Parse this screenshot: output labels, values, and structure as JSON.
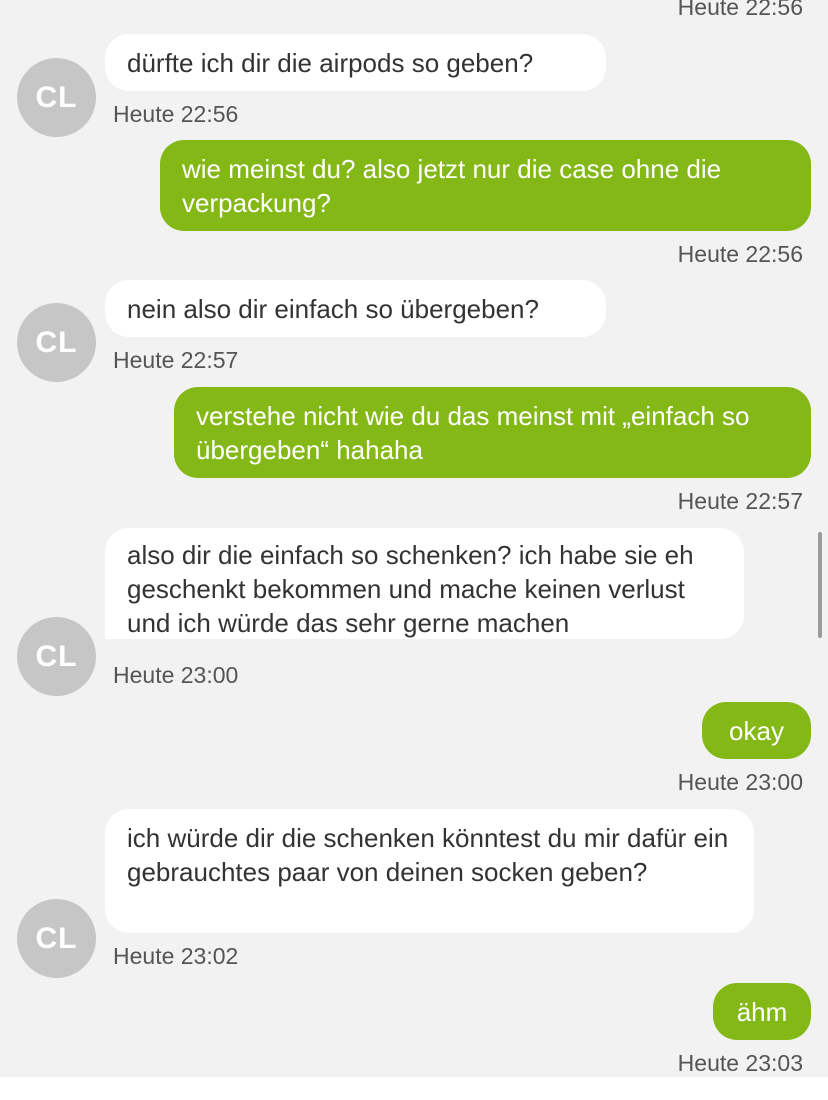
{
  "colors": {
    "outgoing_bubble": "#84b817",
    "incoming_bubble": "#ffffff",
    "background": "#f2f2f2",
    "avatar": "#c6c6c6"
  },
  "top_partial_time": "Heute 22:56",
  "contact": {
    "initials": "CL"
  },
  "messages": [
    {
      "direction": "in",
      "text": "dürfte ich dir die airpods so geben?",
      "time": "Heute 22:56"
    },
    {
      "direction": "out",
      "text": "wie meinst du? also jetzt nur die case ohne die verpackung?",
      "time": "Heute 22:56"
    },
    {
      "direction": "in",
      "text": "nein also dir einfach so übergeben?",
      "time": "Heute 22:57"
    },
    {
      "direction": "out",
      "text": "verstehe nicht wie du das meinst mit „einfach so übergeben“ hahaha",
      "time": "Heute 22:57"
    },
    {
      "direction": "in",
      "text": "also dir die einfach so schenken? ich habe sie eh geschenkt bekommen und mache keinen verlust und ich würde das sehr gerne machen",
      "time": "Heute 23:00"
    },
    {
      "direction": "out",
      "text": "okay",
      "time": "Heute 23:00"
    },
    {
      "direction": "in",
      "text": "ich würde dir die schenken könntest du mir dafür ein gebrauchtes paar von deinen socken geben?",
      "time": "Heute 23:02"
    },
    {
      "direction": "out",
      "text": "ähm",
      "time": "Heute 23:03"
    }
  ]
}
